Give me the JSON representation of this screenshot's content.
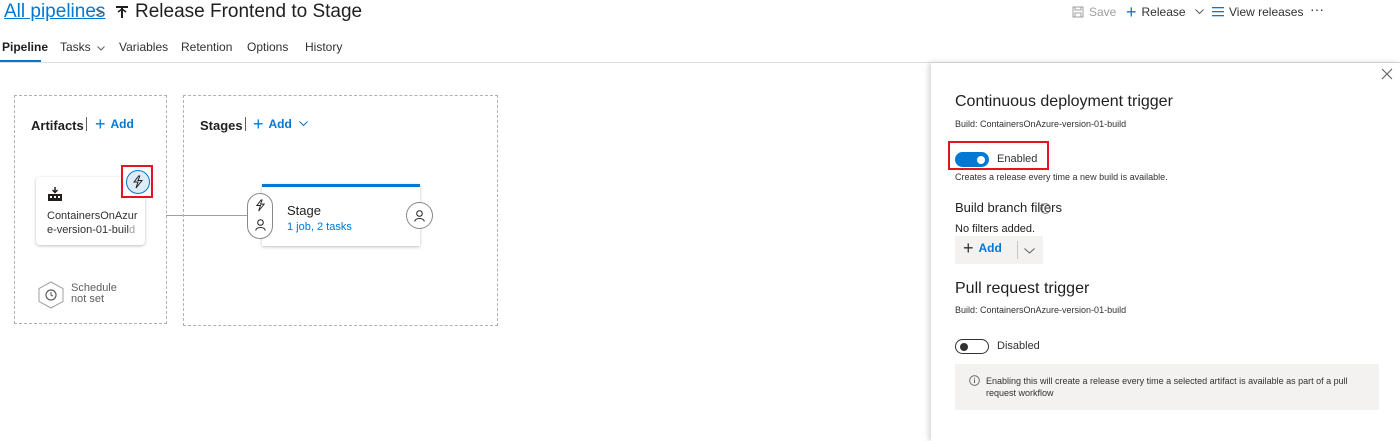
{
  "header": {
    "breadcrumb_root": "All pipelines",
    "breadcrumb_sep": ">",
    "title": "Release Frontend to Stage",
    "save_label": "Save",
    "release_label": "Release",
    "view_releases_label": "View releases",
    "more_label": "···"
  },
  "tabs": [
    {
      "label": "Pipeline"
    },
    {
      "label": "Tasks"
    },
    {
      "label": "Variables"
    },
    {
      "label": "Retention"
    },
    {
      "label": "Options"
    },
    {
      "label": "History"
    }
  ],
  "artifacts": {
    "heading": "Artifacts",
    "add_label": "Add",
    "artifact_name_main": "ContainersOnAzur e-version-01-buil",
    "artifact_name_fade": "d",
    "schedule_line1": "Schedule",
    "schedule_line2": "not set"
  },
  "stages": {
    "heading": "Stages",
    "add_label": "Add",
    "stage_name": "Stage",
    "stage_summary": "1 job, 2 tasks"
  },
  "panel": {
    "cd_title": "Continuous deployment trigger",
    "cd_build": "Build: ContainersOnAzure-version-01-build",
    "cd_toggle_label": "Enabled",
    "cd_description": "Creates a release every time a new build is available.",
    "filters_title": "Build branch filters",
    "filters_empty": "No filters added.",
    "filters_add_label": "Add",
    "pr_title": "Pull request trigger",
    "pr_build": "Build: ContainersOnAzure-version-01-build",
    "pr_toggle_label": "Disabled",
    "pr_info": "Enabling this will create a release every time a selected artifact is available as part of a pull request workflow"
  },
  "colors": {
    "accent": "#0078d4",
    "highlight": "#e81123"
  }
}
